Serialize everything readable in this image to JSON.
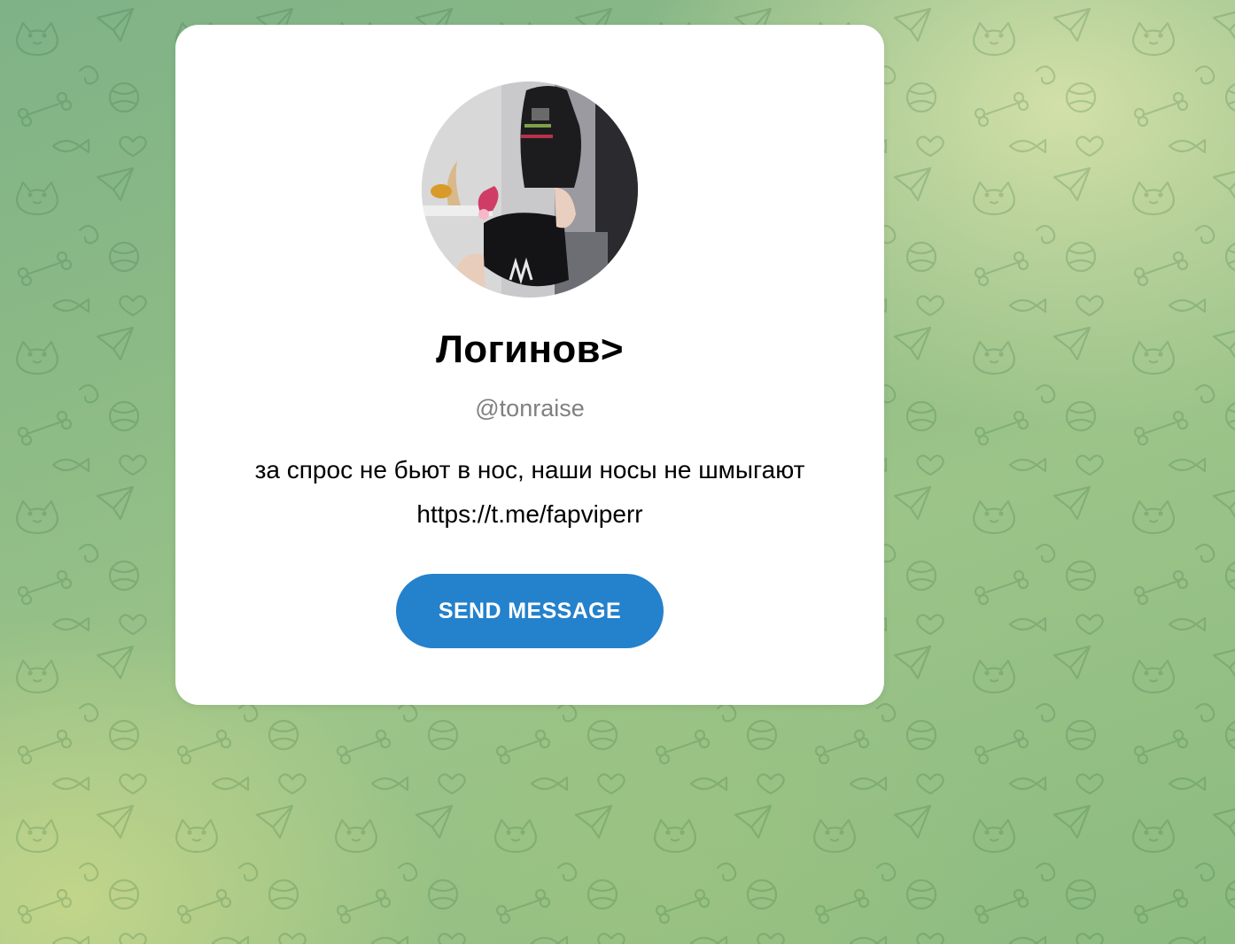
{
  "profile": {
    "name": "Логинов>",
    "username": "@tonraise",
    "bio_line1": "за спрос не бьют в нос, наши носы не шмыгают",
    "bio_line2": "https://t.me/fapviperr"
  },
  "actions": {
    "send_message_label": "SEND MESSAGE"
  },
  "colors": {
    "accent": "#2481cc",
    "username": "#808080",
    "card": "#ffffff"
  },
  "icons": {
    "background": "telegram-doodle-pattern"
  }
}
